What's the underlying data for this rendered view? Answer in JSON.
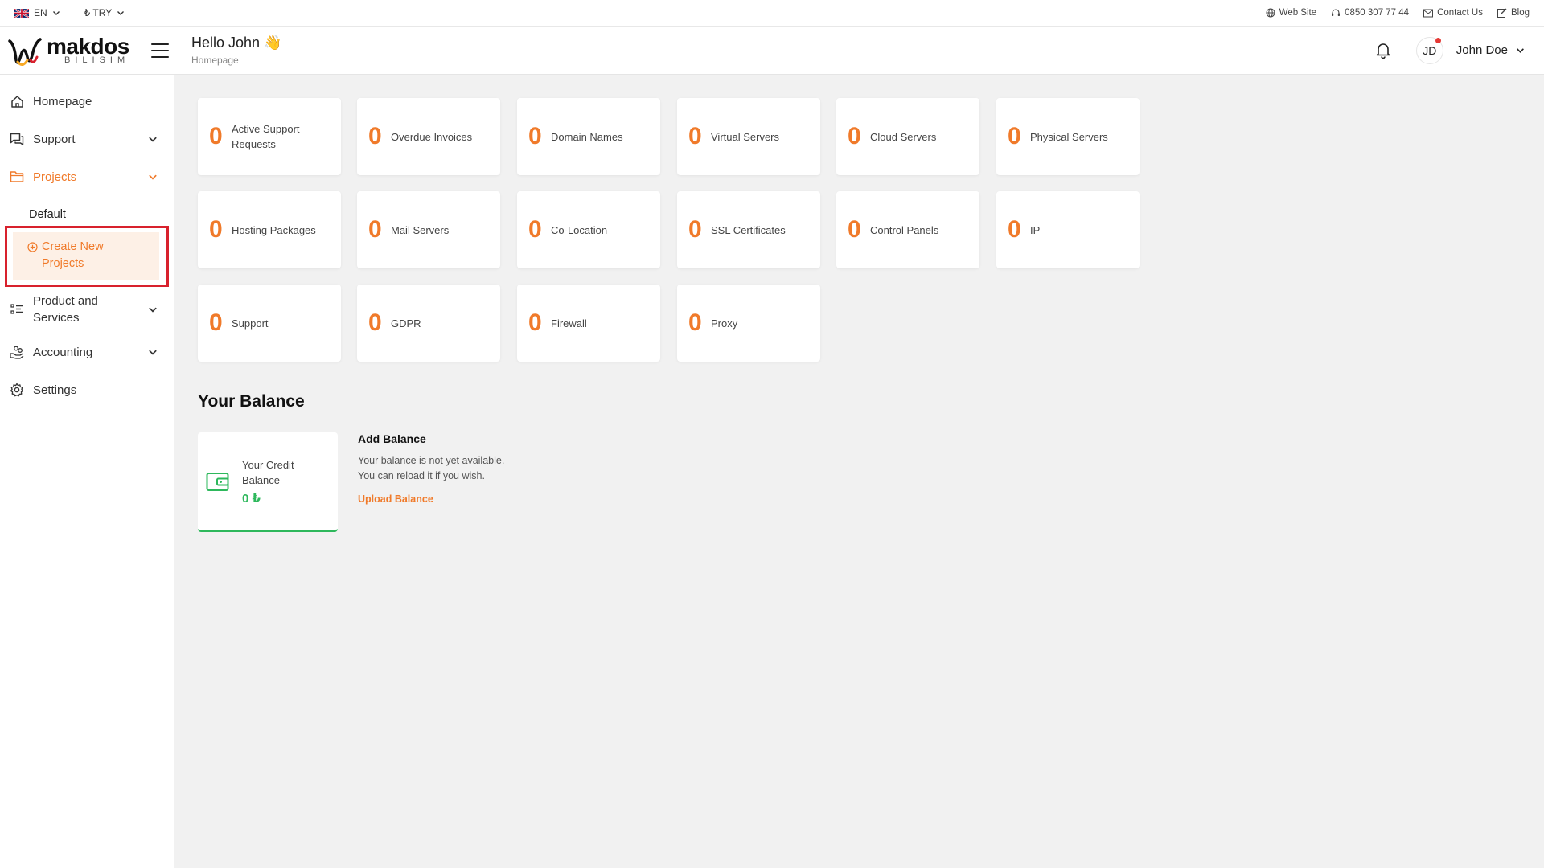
{
  "topbar": {
    "language": "EN",
    "currency": "₺ TRY",
    "links": {
      "website": "Web Site",
      "phone": "0850 307 77 44",
      "contact": "Contact Us",
      "blog": "Blog"
    }
  },
  "brand": {
    "name": "makdos",
    "tagline": "BILISIM"
  },
  "header": {
    "greeting": "Hello John 👋",
    "breadcrumb": "Homepage",
    "avatar_initials": "JD",
    "user_name": "John Doe"
  },
  "sidebar": {
    "homepage": "Homepage",
    "support": "Support",
    "projects": "Projects",
    "projects_default": "Default",
    "create_new_projects": "Create New Projects",
    "product_services": "Product and Services",
    "accounting": "Accounting",
    "settings": "Settings"
  },
  "stats": [
    {
      "value": "0",
      "label": "Active Support Requests"
    },
    {
      "value": "0",
      "label": "Overdue Invoices"
    },
    {
      "value": "0",
      "label": "Domain Names"
    },
    {
      "value": "0",
      "label": "Virtual Servers"
    },
    {
      "value": "0",
      "label": "Cloud Servers"
    },
    {
      "value": "0",
      "label": "Physical Servers"
    },
    {
      "value": "0",
      "label": "Hosting Packages"
    },
    {
      "value": "0",
      "label": "Mail Servers"
    },
    {
      "value": "0",
      "label": "Co-Location"
    },
    {
      "value": "0",
      "label": "SSL Certificates"
    },
    {
      "value": "0",
      "label": "Control Panels"
    },
    {
      "value": "0",
      "label": "IP"
    },
    {
      "value": "0",
      "label": "Support"
    },
    {
      "value": "0",
      "label": "GDPR"
    },
    {
      "value": "0",
      "label": "Firewall"
    },
    {
      "value": "0",
      "label": "Proxy"
    }
  ],
  "balance": {
    "title": "Your Balance",
    "credit_label": "Your Credit Balance",
    "credit_amount": "0 ₺",
    "add_title": "Add Balance",
    "add_desc_1": "Your balance is not yet available.",
    "add_desc_2": "You can reload it if you wish.",
    "upload_link": "Upload Balance"
  },
  "colors": {
    "accent": "#f07a2a",
    "success": "#2eb85c",
    "highlight": "#d8212d"
  }
}
